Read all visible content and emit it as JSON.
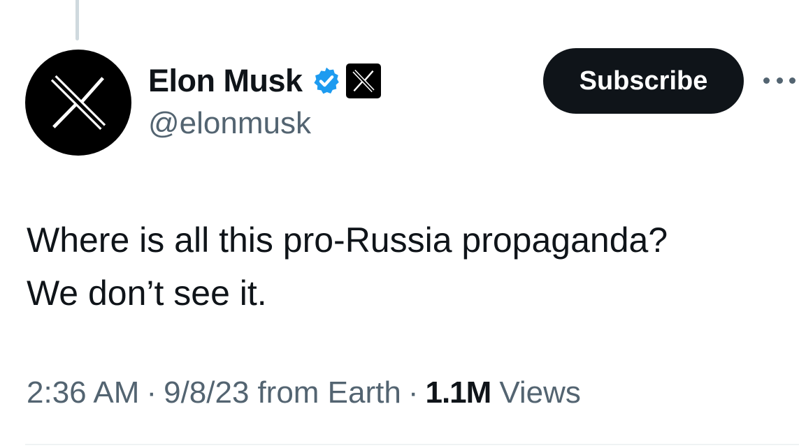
{
  "author": {
    "display_name": "Elon Musk",
    "handle": "@elonmusk",
    "avatar_icon": "x-logo-icon",
    "verified_icon": "verified-badge-icon",
    "verified_color": "#1d9bf0",
    "affiliate_icon": "x-affiliate-badge-icon"
  },
  "actions": {
    "subscribe_label": "Subscribe",
    "more_icon": "more-options-icon"
  },
  "tweet": {
    "lines": [
      "Where is all this pro-Russia propaganda?",
      "We don’t see it."
    ]
  },
  "meta": {
    "time": "2:36 AM",
    "separator": "·",
    "date": "9/8/23",
    "source": "from Earth",
    "views_count": "1.1M",
    "views_label": "Views"
  },
  "colors": {
    "text_primary": "#0f1419",
    "text_secondary": "#536471",
    "button_bg": "#0f1419",
    "thread_line": "#cfd9de"
  }
}
